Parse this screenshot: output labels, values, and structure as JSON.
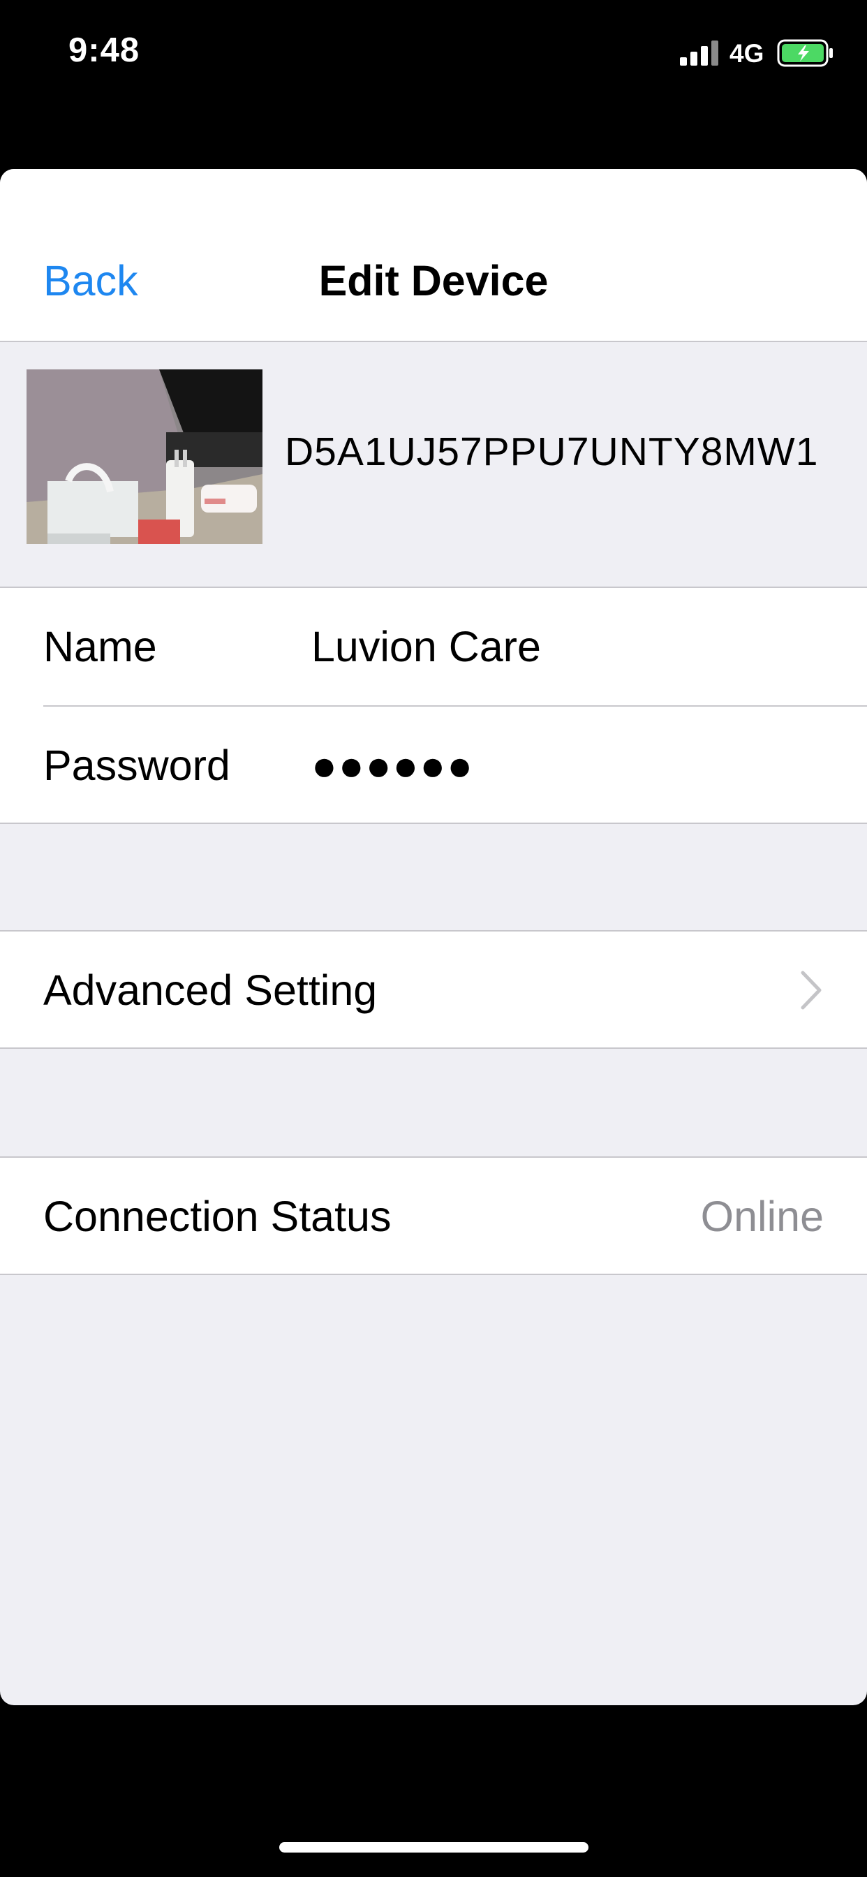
{
  "status_bar": {
    "time": "9:48",
    "network": "4G",
    "icons": [
      "signal-icon",
      "battery-charging-icon"
    ]
  },
  "nav": {
    "back_label": "Back",
    "title": "Edit Device"
  },
  "device": {
    "id": "D5A1UJ57PPU7UNTY8MW1",
    "thumbnail_icon": "camera-snapshot-image"
  },
  "fields": {
    "name_label": "Name",
    "name_value": "Luvion Care",
    "password_label": "Password",
    "password_value": "●●●●●●"
  },
  "advanced": {
    "label": "Advanced Setting",
    "icon": "chevron-right-icon"
  },
  "connection": {
    "label": "Connection Status",
    "value": "Online"
  },
  "colors": {
    "accent": "#1e87f0",
    "background": "#efeff4",
    "secondary_text": "#8e8e93",
    "battery_green": "#4cd964"
  }
}
